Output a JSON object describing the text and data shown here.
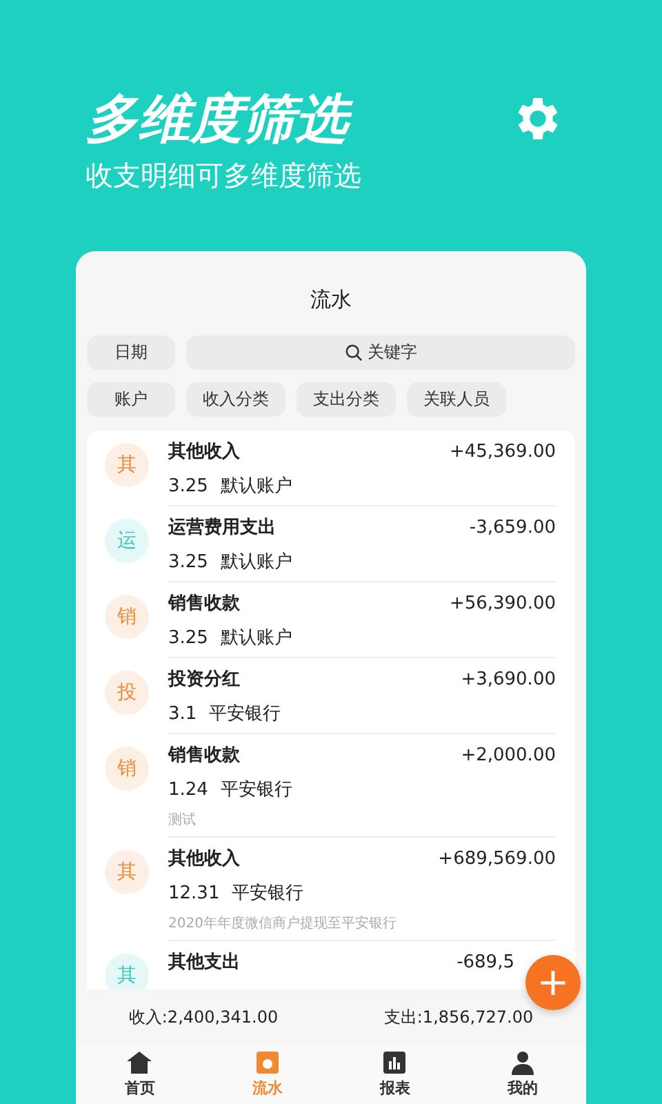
{
  "header": {
    "title": "多维度筛选",
    "subtitle": "收支明细可多维度筛选"
  },
  "card": {
    "title": "流水",
    "filters": [
      {
        "label": "日期",
        "kind": "chip"
      },
      {
        "label": "关键字",
        "kind": "search"
      },
      {
        "label": "账户",
        "kind": "chip"
      },
      {
        "label": "收入分类",
        "kind": "chip"
      },
      {
        "label": "支出分类",
        "kind": "chip"
      },
      {
        "label": "关联人员",
        "kind": "chip"
      }
    ],
    "records": [
      {
        "badge": "其",
        "kind": "income",
        "title": "其他收入",
        "amount": "+45,369.00",
        "date": "3.25",
        "account": "默认账户"
      },
      {
        "badge": "运",
        "kind": "expense",
        "title": "运营费用支出",
        "amount": "-3,659.00",
        "date": "3.25",
        "account": "默认账户"
      },
      {
        "badge": "销",
        "kind": "income",
        "title": "销售收款",
        "amount": "+56,390.00",
        "date": "3.25",
        "account": "默认账户"
      },
      {
        "badge": "投",
        "kind": "income",
        "title": "投资分红",
        "amount": "+3,690.00",
        "date": "3.1",
        "account": "平安银行"
      },
      {
        "badge": "销",
        "kind": "income",
        "title": "销售收款",
        "amount": "+2,000.00",
        "date": "1.24",
        "account": "平安银行",
        "note": "测试"
      },
      {
        "badge": "其",
        "kind": "income",
        "title": "其他收入",
        "amount": "+689,569.00",
        "date": "12.31",
        "account": "平安银行",
        "note": "2020年年度微信商户提现至平安银行"
      },
      {
        "badge": "其",
        "kind": "expense",
        "title": "其他支出",
        "amount": "-689,5"
      }
    ],
    "add_button": "+",
    "summary": {
      "income": "收入:2,400,341.00",
      "expense": "支出:1,856,727.00"
    },
    "tabs": [
      {
        "label": "首页",
        "kind": "home",
        "selected": false
      },
      {
        "label": "流水",
        "kind": "flow",
        "selected": true
      },
      {
        "label": "报表",
        "kind": "report",
        "selected": false
      },
      {
        "label": "我的",
        "kind": "me",
        "selected": false
      }
    ]
  }
}
